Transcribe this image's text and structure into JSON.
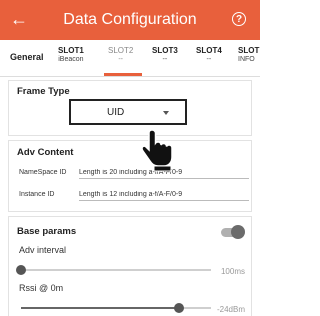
{
  "header": {
    "back_icon": "back-arrow-icon",
    "back_glyph": "←",
    "title": "Data Configuration",
    "help_glyph": "?",
    "accent_color": "#e8603c"
  },
  "tabs": [
    {
      "label": "General",
      "sub": ""
    },
    {
      "label": "SLOT1",
      "sub": "iBeacon"
    },
    {
      "label": "SLOT2",
      "sub": "--",
      "active": true
    },
    {
      "label": "SLOT3",
      "sub": "--"
    },
    {
      "label": "SLOT4",
      "sub": "--"
    },
    {
      "label": "SLOT",
      "sub": "INFO"
    }
  ],
  "frame_type": {
    "title": "Frame Type",
    "value": "UID"
  },
  "adv_content": {
    "title": "Adv Content",
    "fields": [
      {
        "label": "NameSpace ID",
        "placeholder": "Length is 20 including a-f/A-F/0-9"
      },
      {
        "label": "Instance ID",
        "placeholder": "Length is 12 including a-f/A-F/0-9"
      }
    ]
  },
  "base_params": {
    "title": "Base params",
    "toggle_on": true,
    "adv_interval": {
      "label": "Adv interval",
      "value": "100ms",
      "fraction": 0.0
    },
    "rssi": {
      "label": "Rssi @ 0m",
      "value": "-24dBm",
      "fraction": 0.83
    }
  }
}
